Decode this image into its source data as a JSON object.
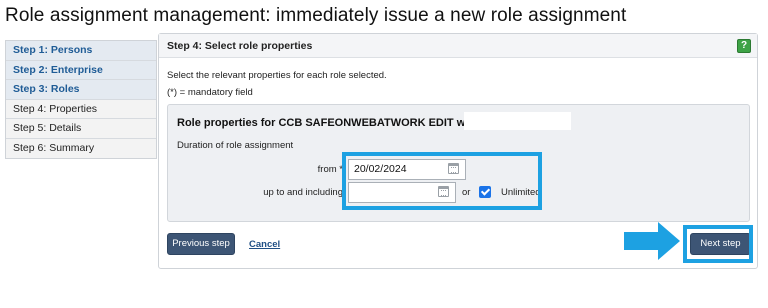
{
  "page": {
    "title": "Role assignment management: immediately issue a new role assignment"
  },
  "steps": [
    {
      "label": "Step 1: Persons",
      "state": "done"
    },
    {
      "label": "Step 2: Enterprise",
      "state": "done"
    },
    {
      "label": "Step 3: Roles",
      "state": "done"
    },
    {
      "label": "Step 4: Properties",
      "state": "current"
    },
    {
      "label": "Step 5: Details",
      "state": "todo"
    },
    {
      "label": "Step 6: Summary",
      "state": "todo"
    }
  ],
  "panel": {
    "title": "Step 4: Select role properties",
    "help_icon": "?",
    "instruction": "Select the relevant properties for each role selected.",
    "mandatory_note": "(*) = mandatory field",
    "role": {
      "title": "Role properties for CCB SAFEONWEBATWORK EDIT within enterprise",
      "duration_label": "Duration of role assignment",
      "from_label": "from *",
      "from_value": "20/02/2024",
      "until_label": "up to and including",
      "until_value": "",
      "or_text": "or",
      "unlimited_label": "Unlimited",
      "unlimited_checked": true
    },
    "buttons": {
      "previous": "Previous step",
      "cancel": "Cancel",
      "next": "Next step"
    }
  },
  "colors": {
    "highlight": "#1da1e2",
    "button": "#3d5575",
    "help": "#3ea346",
    "step_link": "#1f5c96"
  }
}
